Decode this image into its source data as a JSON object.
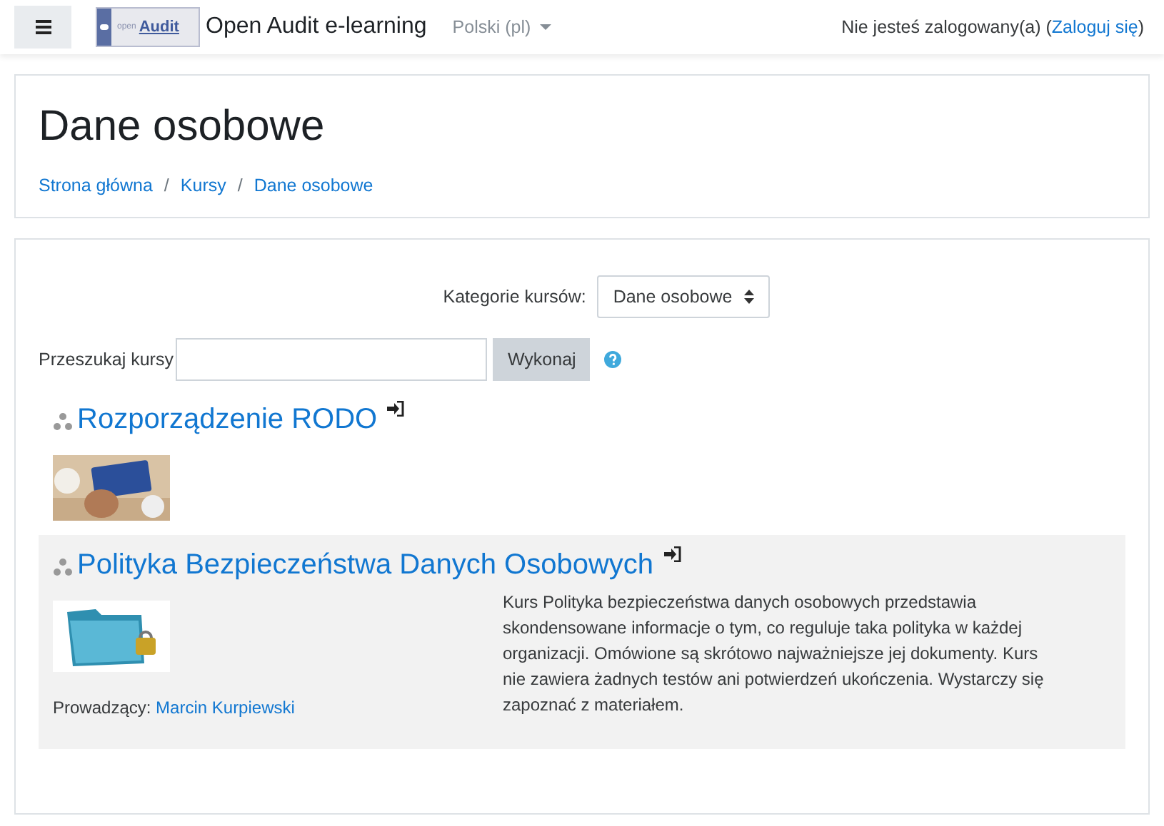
{
  "navbar": {
    "logo": {
      "small": "open",
      "big": "Audit"
    },
    "site_name": "Open Audit e-learning",
    "language": "Polski (pl)",
    "login_text": "Nie jesteś zalogowany(a) (",
    "login_link": "Zaloguj się",
    "login_end": ")"
  },
  "header": {
    "title": "Dane osobowe",
    "breadcrumbs": [
      "Strona główna",
      "Kursy",
      "Dane osobowe"
    ],
    "separator": "/"
  },
  "category": {
    "label": "Kategorie kursów:",
    "value": "Dane osobowe"
  },
  "search": {
    "label": "Przeszukaj kursy",
    "button": "Wykonaj"
  },
  "courses": [
    {
      "title": "Rozporządzenie RODO",
      "shaded": false
    },
    {
      "title": "Polityka Bezpieczeństwa Danych Osobowych",
      "shaded": true,
      "teacher_label": "Prowadzący:",
      "teacher": "Marcin Kurpiewski",
      "summary": "Kurs Polityka bezpieczeństwa danych osobowych przedstawia skondensowane informacje o tym, co reguluje taka polityka w każdej organizacji. Omówione są skrótowo najważniejsze jej dokumenty. Kurs nie zawiera żadnych testów ani potwierdzeń ukończenia. Wystarczy się zapoznać z materiałem."
    }
  ]
}
